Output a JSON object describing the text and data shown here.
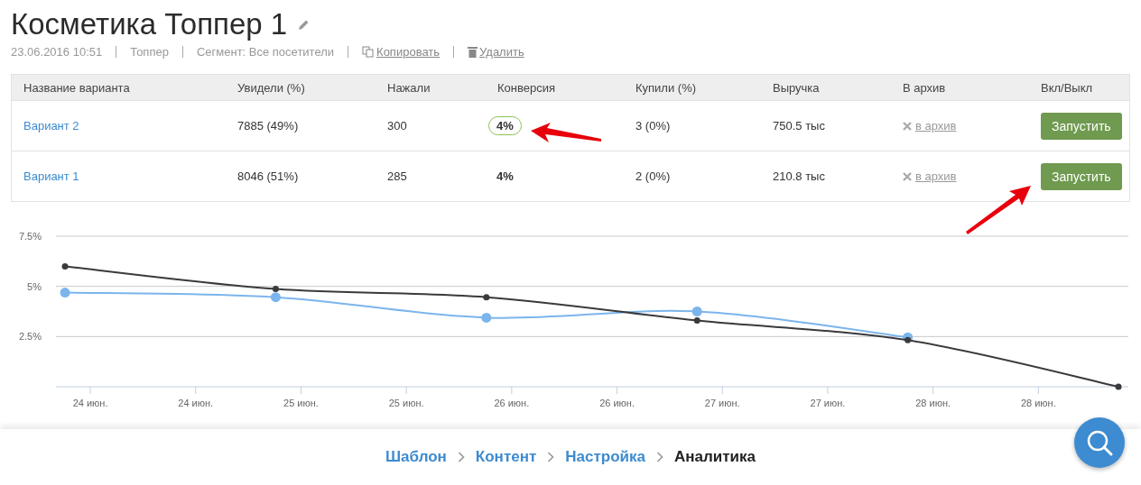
{
  "title": "Косметика Топпер 1",
  "meta": {
    "date": "23.06.2016 10:51",
    "type": "Топпер",
    "segment": "Сегмент: Все посетители",
    "copy": "Копировать",
    "delete": "Удалить"
  },
  "table": {
    "columns": [
      "Название варианта",
      "Увидели (%)",
      "Нажали",
      "Конверсия",
      "Купили (%)",
      "Выручка",
      "В архив",
      "Вкл/Выкл"
    ],
    "rows": [
      {
        "name": "Вариант 2",
        "seen": "7885 (49%)",
        "clicked": "300",
        "conversion": "4%",
        "highlighted": true,
        "bought": "3 (0%)",
        "revenue": "750.5 тыс",
        "archive": "в архив",
        "button": "Запустить"
      },
      {
        "name": "Вариант 1",
        "seen": "8046 (51%)",
        "clicked": "285",
        "conversion": "4%",
        "highlighted": false,
        "bought": "2 (0%)",
        "revenue": "210.8 тыс",
        "archive": "в архив",
        "button": "Запустить"
      }
    ]
  },
  "chart": {
    "chart_data": {
      "type": "line",
      "x": [
        23.88,
        24.88,
        25.88,
        26.88,
        27.88,
        28.88
      ],
      "xlim": [
        23.837,
        28.927
      ],
      "ylim": [
        0,
        7.5
      ],
      "yticks": [
        {
          "value": 2.5,
          "label": "2.5%"
        },
        {
          "value": 5,
          "label": "5%"
        },
        {
          "value": 7.5,
          "label": "7.5%"
        }
      ],
      "xticks": [
        {
          "value": 24,
          "label": "24 июн."
        },
        {
          "value": 24.5,
          "label": "24 июн."
        },
        {
          "value": 25,
          "label": "25 июн."
        },
        {
          "value": 25.5,
          "label": "25 июн."
        },
        {
          "value": 26,
          "label": "26 июн."
        },
        {
          "value": 26.5,
          "label": "26 июн."
        },
        {
          "value": 27,
          "label": "27 июн."
        },
        {
          "value": 27.5,
          "label": "27 июн."
        },
        {
          "value": 28,
          "label": "28 июн."
        },
        {
          "value": 28.5,
          "label": "28 июн."
        }
      ],
      "series": [
        {
          "color": "#3a3a3c",
          "marker": "circle",
          "values": [
            6.0,
            4.87,
            4.46,
            3.3,
            2.32,
            0
          ]
        },
        {
          "color": "#7cb5ec",
          "marker": "circle",
          "values": [
            4.69,
            4.46,
            3.44,
            3.75,
            2.46,
            null
          ]
        }
      ]
    }
  },
  "breadcrumbs": [
    {
      "label": "Шаблон",
      "selected": false
    },
    {
      "label": "Контент",
      "selected": false
    },
    {
      "label": "Настройка",
      "selected": false
    },
    {
      "label": "Аналитика",
      "selected": true
    }
  ]
}
